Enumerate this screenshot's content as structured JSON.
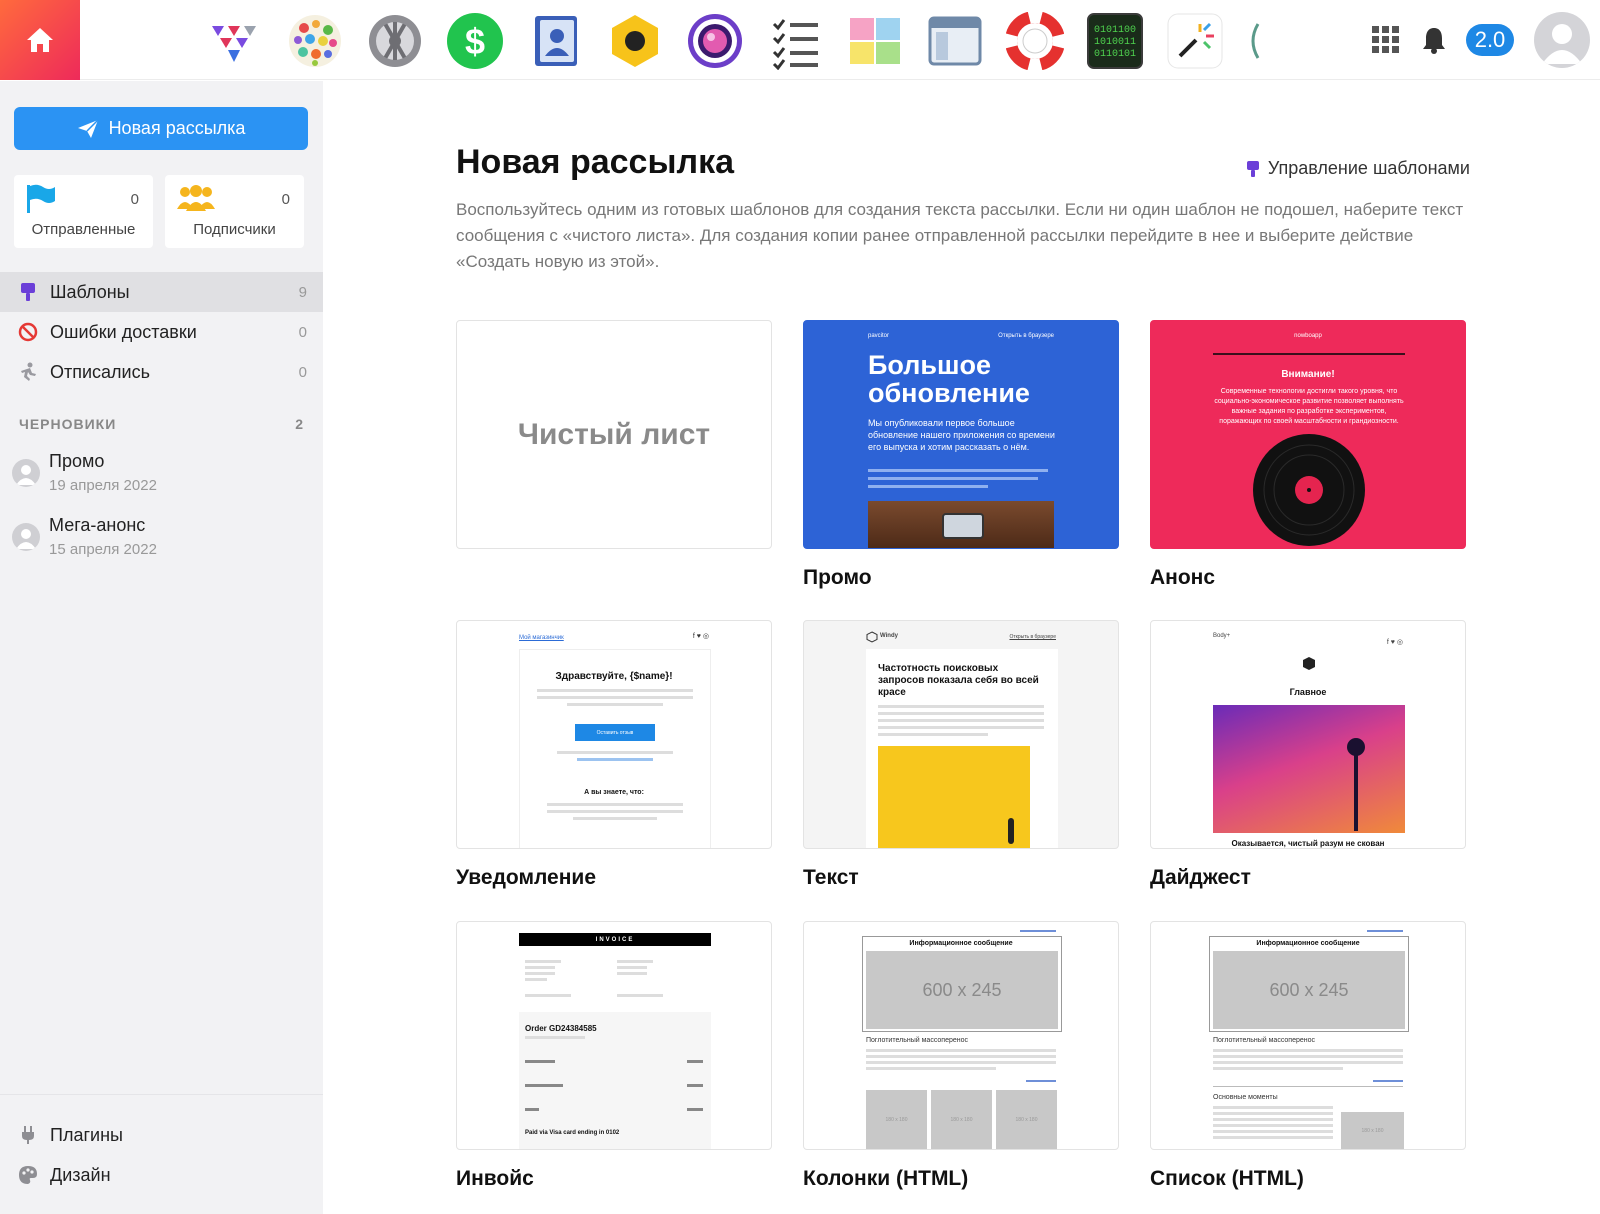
{
  "topbar": {
    "home_icon": "home-icon",
    "apps": [
      {
        "name": "paper-planes-app-icon"
      },
      {
        "name": "color-dots-app-icon"
      },
      {
        "name": "gear-wheel-app-icon"
      },
      {
        "name": "dollar-app-icon"
      },
      {
        "name": "contacts-book-app-icon"
      },
      {
        "name": "hexagon-ball-app-icon"
      },
      {
        "name": "camera-lens-app-icon"
      },
      {
        "name": "checklist-app-icon"
      },
      {
        "name": "sticky-notes-app-icon"
      },
      {
        "name": "window-layout-app-icon"
      },
      {
        "name": "lifebuoy-app-icon"
      },
      {
        "name": "binary-terminal-app-icon"
      },
      {
        "name": "magic-wand-app-icon"
      }
    ],
    "version": "2.0"
  },
  "sidebar": {
    "new_mail_label": "Новая рассылка",
    "stats": [
      {
        "label": "Отправленные",
        "count": "0"
      },
      {
        "label": "Подписчики",
        "count": "0"
      }
    ],
    "nav": [
      {
        "label": "Шаблоны",
        "count": "9"
      },
      {
        "label": "Ошибки доставки",
        "count": "0"
      },
      {
        "label": "Отписались",
        "count": "0"
      }
    ],
    "drafts_title": "ЧЕРНОВИКИ",
    "drafts_count": "2",
    "drafts": [
      {
        "title": "Промо",
        "date": "19 апреля 2022"
      },
      {
        "title": "Мега-анонс",
        "date": "15 апреля 2022"
      }
    ],
    "bottom": [
      {
        "label": "Плагины"
      },
      {
        "label": "Дизайн"
      }
    ]
  },
  "main": {
    "title": "Новая рассылка",
    "manage_templates": "Управление шаблонами",
    "description": "Воспользуйтесь одним из готовых шаблонов для создания текста рассылки. Если ни один шаблон не подошел, наберите текст сообщения с «чистого листа». Для создания копии ранее отправленной рассылки перейдите в нее и выберите действие «Создать новую из этой».",
    "templates": [
      {
        "name": "",
        "thumb_text": "Чистый лист"
      },
      {
        "name": "Промо",
        "thumb_heading": "Большое обновление",
        "thumb_body": "Мы опубликовали первое большое обновление нашего приложения со времени его выпуска и хотим рассказать о нём.",
        "thumb_brand": "pavcitor",
        "thumb_link": "Открыть в браузере"
      },
      {
        "name": "Анонс",
        "thumb_brand": "nowboapp",
        "thumb_heading": "Внимание!",
        "thumb_body": "Современные технологии достигли такого уровня, что социально-экономическое развитие позволяет выполнять важные задания по разработке экспериментов, поражающих по своей масштабности и грандиозности."
      },
      {
        "name": "Уведомление",
        "thumb_heading": "Здравствуйте, {$name}!",
        "thumb_button": "Оставить отзыв",
        "thumb_sub": "А вы знаете, что:",
        "thumb_link": "Мой магазинчик"
      },
      {
        "name": "Текст",
        "thumb_brand": "Windy",
        "thumb_heading": "Частотность поисковых запросов показала себя во всей красе",
        "thumb_link": "Открыть в браузере"
      },
      {
        "name": "Дайджест",
        "thumb_brand": "Body+",
        "thumb_heading": "Главное",
        "thumb_caption": "Оказывается, чистый разум не скован"
      },
      {
        "name": "Инвойс",
        "thumb_heading": "INVOICE",
        "thumb_order": "Order GD24384585",
        "thumb_paid": "Paid via Visa card ending in 0102"
      },
      {
        "name": "Колонки (HTML)",
        "thumb_heading": "Информационное сообщение",
        "thumb_placeholder": "600 x 245",
        "thumb_sub": "Поглотительный массоперенос",
        "thumb_small": "180 x 180"
      },
      {
        "name": "Список (HTML)",
        "thumb_heading": "Информационное сообщение",
        "thumb_placeholder": "600 x 245",
        "thumb_sub": "Поглотительный массоперенос",
        "thumb_list": "Основные моменты",
        "thumb_small": "180 x 180"
      }
    ]
  },
  "colors": {
    "accent_blue": "#2b93f3",
    "home_gradient": "#ee2a5a",
    "promo_bg": "#2d63d6",
    "announce_bg": "#ee2a5a"
  }
}
